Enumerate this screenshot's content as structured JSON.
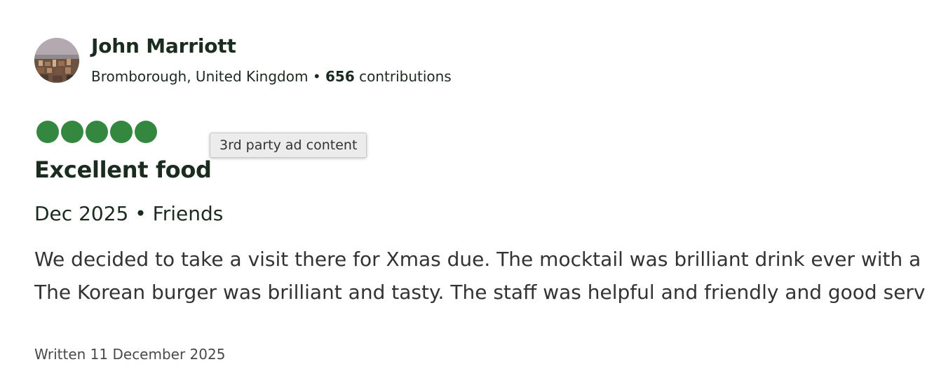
{
  "reviewer": {
    "name": "John Marriott",
    "location": "Bromborough, United Kingdom",
    "separator": " • ",
    "contributions_count": "656",
    "contributions_label": " contributions"
  },
  "rating": {
    "value": 5,
    "max": 5,
    "color": "#34873f"
  },
  "ad_tooltip": {
    "text": "3rd party ad content"
  },
  "review": {
    "title": "Excellent food",
    "visit_info": "Dec 2025 • Friends",
    "body_lines": [
      "We decided to take a visit there for Xmas due. The mocktail was brilliant drink ever with a",
      "The Korean burger was brilliant and tasty. The staff was helpful and friendly and good service"
    ],
    "written": "Written 11 December 2025"
  }
}
